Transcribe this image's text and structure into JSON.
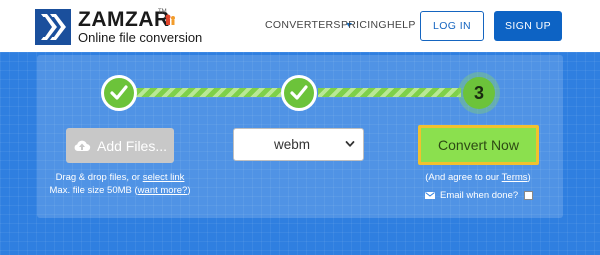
{
  "header": {
    "brand": "ZAMZAR",
    "trademark": "TM",
    "tagline": "Online file conversion",
    "nav": {
      "converters": "CONVERTERS",
      "pricing": "PRICING",
      "help": "HELP"
    },
    "login_label": "LOG IN",
    "signup_label": "SIGN UP"
  },
  "steps": {
    "step1_state": "complete",
    "step2_state": "complete",
    "step3_label": "3"
  },
  "upload": {
    "add_files_label": "Add Files...",
    "drag_text": "Drag & drop files, or ",
    "select_link": "select link",
    "max_size_text": "Max. file size 50MB (",
    "want_more_link": "want more?",
    "max_size_close": ")"
  },
  "format": {
    "selected": "webm"
  },
  "convert": {
    "button_label": "Convert Now",
    "agree_prefix": "(And agree to our ",
    "terms_link": "Terms",
    "agree_suffix": ")",
    "email_label": "Email when done?",
    "email_checked": false
  },
  "colors": {
    "brand_blue": "#0d63c4",
    "hero_blue": "#2f7fe0",
    "step_green": "#6cc33a",
    "convert_green": "#8be04e",
    "convert_highlight": "#f2c12e"
  }
}
